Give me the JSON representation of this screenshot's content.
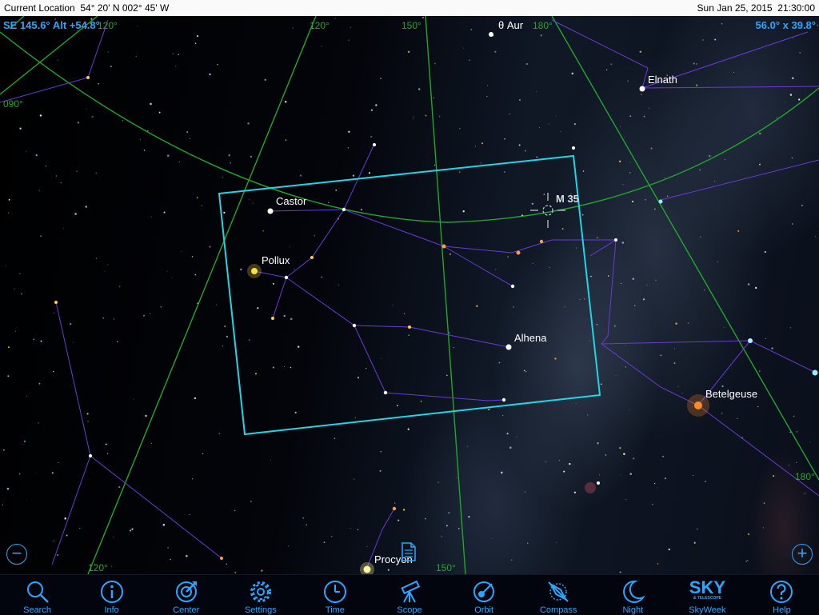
{
  "statusbar": {
    "location": "Current Location  54° 20' N 002° 45' W",
    "datetime": "Sun Jan 25, 2015  21:30:00"
  },
  "hud": {
    "pointing": "SE 145.6° Alt +54.8°",
    "fov": "56.0° x 39.8°",
    "zoom_out": "−",
    "zoom_in": "+"
  },
  "grid_labels": {
    "top_120": "120°",
    "top_150": "150°",
    "top_180": "180°",
    "left_090": "090°",
    "bottom_120": "120°",
    "bottom_150": "150°",
    "right_180": "180°",
    "top_left_120": "120°"
  },
  "objects": {
    "theta_aur": "θ Aur",
    "elnath": "Elnath",
    "castor": "Castor",
    "pollux": "Pollux",
    "m35": "M 35",
    "alhena": "Alhena",
    "betelgeuse": "Betelgeuse",
    "procyon": "Procyon"
  },
  "toolbar": [
    {
      "label": "Search",
      "icon": "search-icon"
    },
    {
      "label": "Info",
      "icon": "info-icon"
    },
    {
      "label": "Center",
      "icon": "center-icon"
    },
    {
      "label": "Settings",
      "icon": "gear-icon"
    },
    {
      "label": "Time",
      "icon": "clock-icon"
    },
    {
      "label": "Scope",
      "icon": "telescope-icon"
    },
    {
      "label": "Orbit",
      "icon": "orbit-icon"
    },
    {
      "label": "Compass",
      "icon": "compass-icon"
    },
    {
      "label": "Night",
      "icon": "moon-icon"
    },
    {
      "label": "SkyWeek",
      "icon": "sky-logo-icon",
      "logo_text": "SKY",
      "logo_sub": "& TELESCOPE"
    },
    {
      "label": "Help",
      "icon": "help-icon"
    }
  ],
  "colors": {
    "accent": "#29a7ff",
    "grid": "#1fa82a",
    "constellation": "#6a3ad6",
    "fov_frame": "#1fd6e6"
  }
}
